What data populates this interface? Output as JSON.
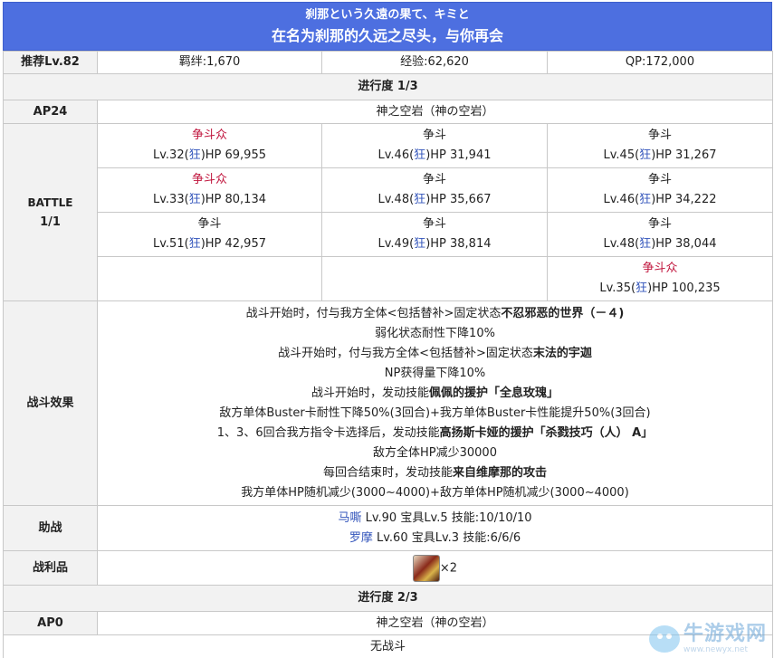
{
  "header": {
    "title_jp": "刹那という久遠の果て、キミと",
    "title_cn": "在名为刹那的久远之尽头，与你再会"
  },
  "summary": {
    "rec_level": "推荐Lv.82",
    "bond": "羁绊:1,670",
    "exp": "经验:62,620",
    "qp": "QP:172,000"
  },
  "progress1": {
    "label": "进行度 1/3",
    "ap": "AP24",
    "location": "神之空岩（神の空岩）",
    "battle_label": "BATTLE",
    "battle_count": "1/1",
    "enemies": [
      [
        {
          "name": "争斗众",
          "red": true,
          "lv": "Lv.32(",
          "cls": "狂",
          "hp": ")HP 69,955"
        },
        {
          "name": "争斗",
          "red": false,
          "lv": "Lv.46(",
          "cls": "狂",
          "hp": ")HP 31,941"
        },
        {
          "name": "争斗",
          "red": false,
          "lv": "Lv.45(",
          "cls": "狂",
          "hp": ")HP 31,267"
        }
      ],
      [
        {
          "name": "争斗众",
          "red": true,
          "lv": "Lv.33(",
          "cls": "狂",
          "hp": ")HP 80,134"
        },
        {
          "name": "争斗",
          "red": false,
          "lv": "Lv.48(",
          "cls": "狂",
          "hp": ")HP 35,667"
        },
        {
          "name": "争斗",
          "red": false,
          "lv": "Lv.46(",
          "cls": "狂",
          "hp": ")HP 34,222"
        }
      ],
      [
        {
          "name": "争斗",
          "red": false,
          "lv": "Lv.51(",
          "cls": "狂",
          "hp": ")HP 42,957"
        },
        {
          "name": "争斗",
          "red": false,
          "lv": "Lv.49(",
          "cls": "狂",
          "hp": ")HP 38,814"
        },
        {
          "name": "争斗",
          "red": false,
          "lv": "Lv.48(",
          "cls": "狂",
          "hp": ")HP 38,044"
        }
      ],
      [
        null,
        null,
        {
          "name": "争斗众",
          "red": true,
          "lv": "Lv.35(",
          "cls": "狂",
          "hp": ")HP 100,235"
        }
      ]
    ],
    "effects_label": "战斗效果",
    "effects": [
      [
        {
          "t": "战斗开始时，付与我方全体<包括替补>固定状态"
        },
        {
          "t": "不忍邪恶的世界（－４)",
          "b": true
        }
      ],
      [
        {
          "t": "弱化状态耐性下降10%"
        }
      ],
      [
        {
          "t": "战斗开始时，付与我方全体<包括替补>固定状态"
        },
        {
          "t": "末法的宇迦",
          "b": true
        }
      ],
      [
        {
          "t": "NP获得量下降10%"
        }
      ],
      [
        {
          "t": "战斗开始时，发动技能"
        },
        {
          "t": "佩佩的援护「全息玫瑰」",
          "b": true
        }
      ],
      [
        {
          "t": "敌方单体Buster卡耐性下降50%(3回合)+我方单体Buster卡性能提升50%(3回合)"
        }
      ],
      [
        {
          "t": "1、3、6回合我方指令卡选择后，发动技能"
        },
        {
          "t": "高扬斯卡娅的援护「杀戮技巧（人） A」",
          "b": true
        }
      ],
      [
        {
          "t": "敌方全体HP减少30000"
        }
      ],
      [
        {
          "t": "每回合结束时，发动技能"
        },
        {
          "t": "来自维摩那的攻击",
          "b": true
        }
      ],
      [
        {
          "t": "我方单体HP随机减少(3000~4000)+敌方单体HP随机减少(3000~4000)"
        }
      ]
    ],
    "support_label": "助战",
    "support": [
      {
        "name": "马嘶",
        "detail": " Lv.90 宝具Lv.5 技能:10/10/10"
      },
      {
        "name": "罗摩",
        "detail": " Lv.60 宝具Lv.3 技能:6/6/6"
      }
    ],
    "drops_label": "战利品",
    "drop_count": "×2"
  },
  "progress2": {
    "label": "进行度 2/3",
    "ap": "AP0",
    "location": "神之空岩（神の空岩）",
    "battle": "无战斗"
  },
  "watermark": {
    "name": "牛游戏网",
    "url": "www.newyx.net"
  }
}
